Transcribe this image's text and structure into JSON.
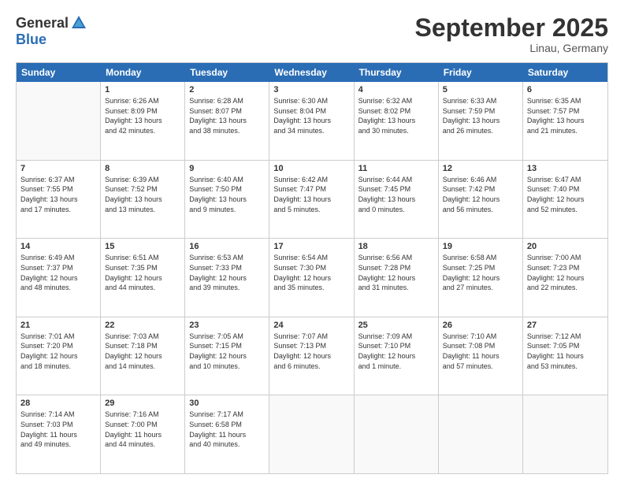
{
  "logo": {
    "general": "General",
    "blue": "Blue"
  },
  "title": "September 2025",
  "location": "Linau, Germany",
  "header": {
    "days": [
      "Sunday",
      "Monday",
      "Tuesday",
      "Wednesday",
      "Thursday",
      "Friday",
      "Saturday"
    ]
  },
  "weeks": [
    [
      {
        "day": "",
        "info": ""
      },
      {
        "day": "1",
        "info": "Sunrise: 6:26 AM\nSunset: 8:09 PM\nDaylight: 13 hours\nand 42 minutes."
      },
      {
        "day": "2",
        "info": "Sunrise: 6:28 AM\nSunset: 8:07 PM\nDaylight: 13 hours\nand 38 minutes."
      },
      {
        "day": "3",
        "info": "Sunrise: 6:30 AM\nSunset: 8:04 PM\nDaylight: 13 hours\nand 34 minutes."
      },
      {
        "day": "4",
        "info": "Sunrise: 6:32 AM\nSunset: 8:02 PM\nDaylight: 13 hours\nand 30 minutes."
      },
      {
        "day": "5",
        "info": "Sunrise: 6:33 AM\nSunset: 7:59 PM\nDaylight: 13 hours\nand 26 minutes."
      },
      {
        "day": "6",
        "info": "Sunrise: 6:35 AM\nSunset: 7:57 PM\nDaylight: 13 hours\nand 21 minutes."
      }
    ],
    [
      {
        "day": "7",
        "info": "Sunrise: 6:37 AM\nSunset: 7:55 PM\nDaylight: 13 hours\nand 17 minutes."
      },
      {
        "day": "8",
        "info": "Sunrise: 6:39 AM\nSunset: 7:52 PM\nDaylight: 13 hours\nand 13 minutes."
      },
      {
        "day": "9",
        "info": "Sunrise: 6:40 AM\nSunset: 7:50 PM\nDaylight: 13 hours\nand 9 minutes."
      },
      {
        "day": "10",
        "info": "Sunrise: 6:42 AM\nSunset: 7:47 PM\nDaylight: 13 hours\nand 5 minutes."
      },
      {
        "day": "11",
        "info": "Sunrise: 6:44 AM\nSunset: 7:45 PM\nDaylight: 13 hours\nand 0 minutes."
      },
      {
        "day": "12",
        "info": "Sunrise: 6:46 AM\nSunset: 7:42 PM\nDaylight: 12 hours\nand 56 minutes."
      },
      {
        "day": "13",
        "info": "Sunrise: 6:47 AM\nSunset: 7:40 PM\nDaylight: 12 hours\nand 52 minutes."
      }
    ],
    [
      {
        "day": "14",
        "info": "Sunrise: 6:49 AM\nSunset: 7:37 PM\nDaylight: 12 hours\nand 48 minutes."
      },
      {
        "day": "15",
        "info": "Sunrise: 6:51 AM\nSunset: 7:35 PM\nDaylight: 12 hours\nand 44 minutes."
      },
      {
        "day": "16",
        "info": "Sunrise: 6:53 AM\nSunset: 7:33 PM\nDaylight: 12 hours\nand 39 minutes."
      },
      {
        "day": "17",
        "info": "Sunrise: 6:54 AM\nSunset: 7:30 PM\nDaylight: 12 hours\nand 35 minutes."
      },
      {
        "day": "18",
        "info": "Sunrise: 6:56 AM\nSunset: 7:28 PM\nDaylight: 12 hours\nand 31 minutes."
      },
      {
        "day": "19",
        "info": "Sunrise: 6:58 AM\nSunset: 7:25 PM\nDaylight: 12 hours\nand 27 minutes."
      },
      {
        "day": "20",
        "info": "Sunrise: 7:00 AM\nSunset: 7:23 PM\nDaylight: 12 hours\nand 22 minutes."
      }
    ],
    [
      {
        "day": "21",
        "info": "Sunrise: 7:01 AM\nSunset: 7:20 PM\nDaylight: 12 hours\nand 18 minutes."
      },
      {
        "day": "22",
        "info": "Sunrise: 7:03 AM\nSunset: 7:18 PM\nDaylight: 12 hours\nand 14 minutes."
      },
      {
        "day": "23",
        "info": "Sunrise: 7:05 AM\nSunset: 7:15 PM\nDaylight: 12 hours\nand 10 minutes."
      },
      {
        "day": "24",
        "info": "Sunrise: 7:07 AM\nSunset: 7:13 PM\nDaylight: 12 hours\nand 6 minutes."
      },
      {
        "day": "25",
        "info": "Sunrise: 7:09 AM\nSunset: 7:10 PM\nDaylight: 12 hours\nand 1 minute."
      },
      {
        "day": "26",
        "info": "Sunrise: 7:10 AM\nSunset: 7:08 PM\nDaylight: 11 hours\nand 57 minutes."
      },
      {
        "day": "27",
        "info": "Sunrise: 7:12 AM\nSunset: 7:05 PM\nDaylight: 11 hours\nand 53 minutes."
      }
    ],
    [
      {
        "day": "28",
        "info": "Sunrise: 7:14 AM\nSunset: 7:03 PM\nDaylight: 11 hours\nand 49 minutes."
      },
      {
        "day": "29",
        "info": "Sunrise: 7:16 AM\nSunset: 7:00 PM\nDaylight: 11 hours\nand 44 minutes."
      },
      {
        "day": "30",
        "info": "Sunrise: 7:17 AM\nSunset: 6:58 PM\nDaylight: 11 hours\nand 40 minutes."
      },
      {
        "day": "",
        "info": ""
      },
      {
        "day": "",
        "info": ""
      },
      {
        "day": "",
        "info": ""
      },
      {
        "day": "",
        "info": ""
      }
    ]
  ]
}
